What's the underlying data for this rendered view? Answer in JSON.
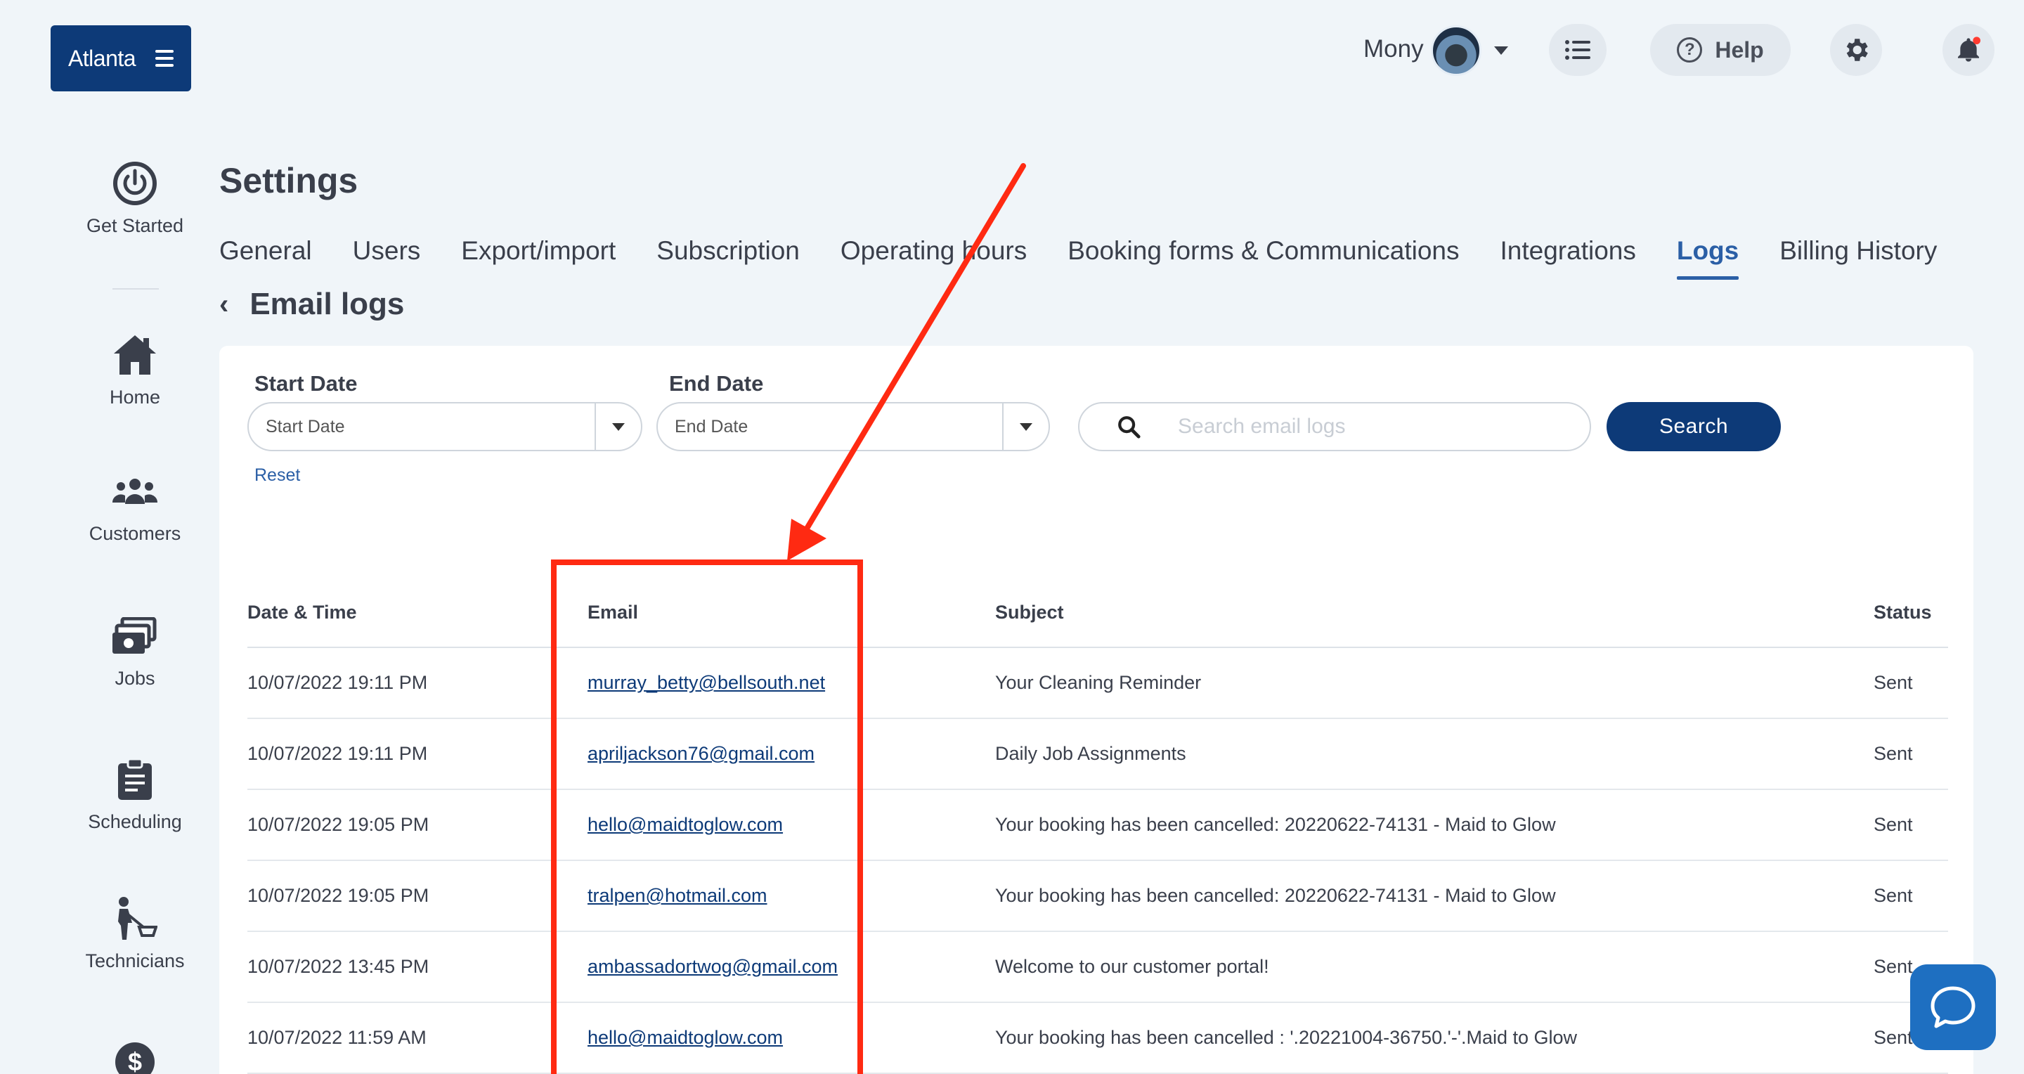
{
  "brand": {
    "name": "Atlanta"
  },
  "topbar": {
    "user_name": "Mony",
    "help_label": "Help"
  },
  "nav": {
    "get_started": "Get Started",
    "home": "Home",
    "customers": "Customers",
    "jobs": "Jobs",
    "scheduling": "Scheduling",
    "technicians": "Technicians"
  },
  "page": {
    "title": "Settings",
    "subtitle": "Email logs"
  },
  "tabs": [
    {
      "label": "General"
    },
    {
      "label": "Users"
    },
    {
      "label": "Export/import"
    },
    {
      "label": "Subscription"
    },
    {
      "label": "Operating hours"
    },
    {
      "label": "Booking forms & Communications"
    },
    {
      "label": "Integrations"
    },
    {
      "label": "Logs",
      "active": true
    },
    {
      "label": "Billing History"
    }
  ],
  "filters": {
    "start_date_label": "Start Date",
    "start_date_placeholder": "Start Date",
    "end_date_label": "End Date",
    "end_date_placeholder": "End Date",
    "search_placeholder": "Search email logs",
    "search_button": "Search",
    "reset_link": "Reset"
  },
  "table": {
    "headers": {
      "date": "Date & Time",
      "email": "Email",
      "subject": "Subject",
      "status": "Status"
    },
    "rows": [
      {
        "date": "10/07/2022 19:11 PM",
        "email": "murray_betty@bellsouth.net",
        "subject": "Your Cleaning Reminder",
        "status": "Sent"
      },
      {
        "date": "10/07/2022 19:11 PM",
        "email": "apriljackson76@gmail.com",
        "subject": "Daily Job Assignments",
        "status": "Sent"
      },
      {
        "date": "10/07/2022 19:05 PM",
        "email": "hello@maidtoglow.com",
        "subject": "Your booking has been cancelled: 20220622-74131 - Maid to Glow",
        "status": "Sent"
      },
      {
        "date": "10/07/2022 19:05 PM",
        "email": "tralpen@hotmail.com",
        "subject": "Your booking has been cancelled: 20220622-74131 - Maid to Glow",
        "status": "Sent"
      },
      {
        "date": "10/07/2022 13:45 PM",
        "email": "ambassadortwog@gmail.com",
        "subject": "Welcome to our customer portal!",
        "status": "Sent"
      },
      {
        "date": "10/07/2022 11:59 AM",
        "email": "hello@maidtoglow.com",
        "subject": "Your booking has been cancelled : '.20221004-36750.'-'.Maid to Glow",
        "status": "Sent"
      }
    ]
  },
  "colors": {
    "brand": "#0d3a78",
    "accent": "#2b5fa6",
    "annotation": "#ff2a12",
    "chat": "#1e6fc1",
    "background": "#f0f5f9"
  },
  "icons": {
    "brand_menu": "hamburger-icon",
    "topbar": [
      "list-icon",
      "help-circle-icon",
      "gear-icon",
      "bell-icon"
    ],
    "nav": [
      "power-icon",
      "home-icon",
      "customers-icon",
      "jobs-icon",
      "scheduling-icon",
      "technicians-icon",
      "dollar-icon"
    ],
    "chat": "chat-icon"
  }
}
